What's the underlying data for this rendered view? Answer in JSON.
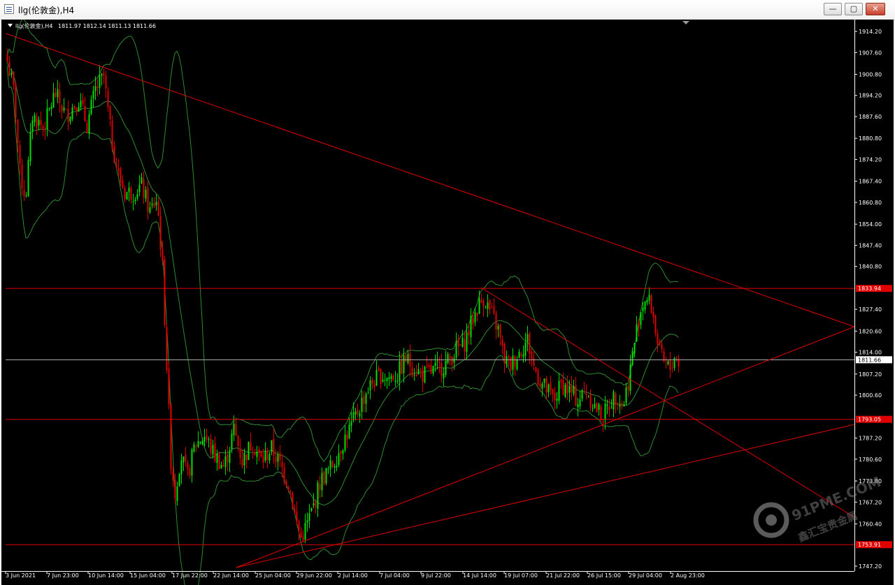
{
  "window": {
    "title": "llg(伦敦金),H4",
    "min_label": "—",
    "max_label": "▢",
    "close_label": "✕"
  },
  "chart": {
    "symbol": "llg(伦敦金),H4",
    "ohlc": "1811.97 1812.14 1811.13 1811.66",
    "current_price": "1811.66",
    "current_price_value": 1811.66,
    "level_labels": [
      "1833.94",
      "1793.05",
      "1753.91"
    ],
    "level_values": [
      1833.94,
      1793.05,
      1753.91
    ],
    "y_ticks": [
      {
        "label": "1914.20",
        "value": 1914.2
      },
      {
        "label": "1907.60",
        "value": 1907.6
      },
      {
        "label": "1900.80",
        "value": 1900.8
      },
      {
        "label": "1894.20",
        "value": 1894.2
      },
      {
        "label": "1887.60",
        "value": 1887.6
      },
      {
        "label": "1880.80",
        "value": 1880.8
      },
      {
        "label": "1874.20",
        "value": 1874.2
      },
      {
        "label": "1867.40",
        "value": 1867.4
      },
      {
        "label": "1860.80",
        "value": 1860.8
      },
      {
        "label": "1854.00",
        "value": 1854.0
      },
      {
        "label": "1847.40",
        "value": 1847.4
      },
      {
        "label": "1840.80",
        "value": 1840.8
      },
      {
        "label": "1827.40",
        "value": 1827.4
      },
      {
        "label": "1820.60",
        "value": 1820.6
      },
      {
        "label": "1814.00",
        "value": 1814.0
      },
      {
        "label": "1807.20",
        "value": 1807.2
      },
      {
        "label": "1800.60",
        "value": 1800.6
      },
      {
        "label": "1787.20",
        "value": 1787.2
      },
      {
        "label": "1780.60",
        "value": 1780.6
      },
      {
        "label": "1773.80",
        "value": 1773.8
      },
      {
        "label": "1767.20",
        "value": 1767.2
      },
      {
        "label": "1760.40",
        "value": 1760.4
      },
      {
        "label": "1747.20",
        "value": 1747.2
      }
    ],
    "x_ticks": [
      "3 Jun 2021",
      "7 Jun 23:00",
      "10 Jun 14:00",
      "15 Jun 04:00",
      "17 Jun 22:00",
      "22 Jun 14:00",
      "25 Jun 04:00",
      "29 Jun 22:00",
      "2 Jul 14:00",
      "7 Jul 04:00",
      "9 Jul 22:00",
      "14 Jul 14:00",
      "19 Jul 07:00",
      "21 Jul 22:00",
      "26 Jul 15:00",
      "29 Jul 04:00",
      "2 Aug 23:00"
    ],
    "colors": {
      "background": "#000000",
      "bull": "#00e000",
      "bear": "#e00000",
      "trend": "#e00000",
      "bollinger": "#2e8b2e",
      "price_line": "#b0b0b0",
      "axis_text": "#ffffff"
    }
  },
  "watermark": {
    "brand": "91PME.COM",
    "tagline": "鑫汇宝贵金属"
  }
}
